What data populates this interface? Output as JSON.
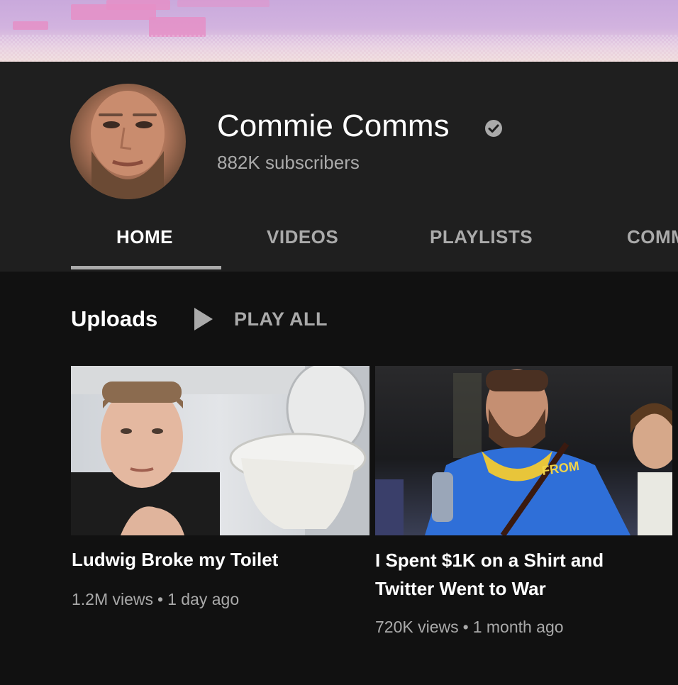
{
  "channel": {
    "name": "Commie Comms",
    "subscribers": "882K subscribers",
    "verified": true
  },
  "tabs": [
    {
      "label": "HOME",
      "active": true
    },
    {
      "label": "VIDEOS",
      "active": false
    },
    {
      "label": "PLAYLISTS",
      "active": false
    },
    {
      "label": "COMM",
      "active": false
    }
  ],
  "uploads": {
    "title": "Uploads",
    "play_all_label": "PLAY ALL"
  },
  "videos": [
    {
      "title": "Ludwig Broke my Toilet",
      "views": "1.2M views",
      "age": "1 day ago"
    },
    {
      "title": "I Spent $1K on a Shirt and Twitter Went to War",
      "views": "720K views",
      "age": "1 month ago"
    },
    {
      "thumbnail_text": "FROM"
    }
  ],
  "colors": {
    "background": "#111111",
    "header_background": "#1f1f1f",
    "secondary_text": "#aaaaaa",
    "primary_text": "#ffffff"
  },
  "meta_separator": "•"
}
